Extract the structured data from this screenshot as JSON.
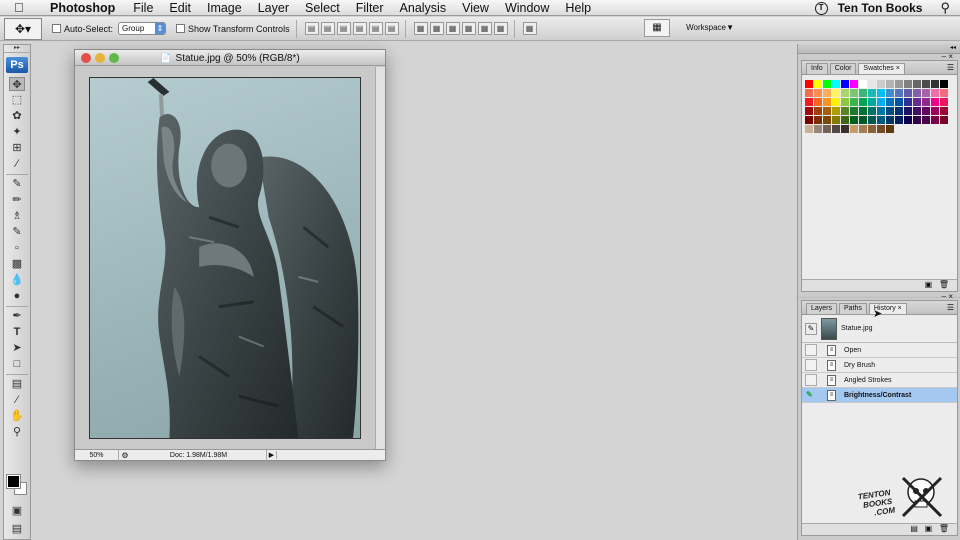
{
  "menubar": {
    "app": "Photoshop",
    "items": [
      "File",
      "Edit",
      "Image",
      "Layer",
      "Select",
      "Filter",
      "Analysis",
      "View",
      "Window",
      "Help"
    ],
    "brand": "Ten Ton Books"
  },
  "options": {
    "auto_select_label": "Auto-Select:",
    "auto_select_value": "Group",
    "transform_label": "Show Transform Controls",
    "workspace_label": "Workspace"
  },
  "toolbox": {
    "logo": "Ps"
  },
  "document": {
    "title": "Statue.jpg @ 50% (RGB/8*)",
    "zoom": "50%",
    "doc_info": "Doc: 1.98M/1.98M"
  },
  "swatches_panel": {
    "tabs": [
      "Info",
      "Color",
      "Swatches"
    ],
    "active_tab": "Swatches",
    "colors": [
      "#ff0000",
      "#ffff00",
      "#00ff00",
      "#00ffff",
      "#0000ff",
      "#ff00ff",
      "#ffffff",
      "#e6e6e6",
      "#cccccc",
      "#b3b3b3",
      "#999999",
      "#808080",
      "#666666",
      "#4d4d4d",
      "#333333",
      "#000000",
      "#f26c4f",
      "#f68e55",
      "#fbaf5c",
      "#fff467",
      "#acd372",
      "#7cc576",
      "#3bb878",
      "#1abbb4",
      "#00bff3",
      "#438ccb",
      "#5574b9",
      "#605ca8",
      "#855fa8",
      "#a763a9",
      "#ef6ea8",
      "#f16d7e",
      "#ed1c24",
      "#f26522",
      "#f7941d",
      "#fff200",
      "#8dc63f",
      "#39b54a",
      "#00a651",
      "#00a99d",
      "#00aeef",
      "#0072bc",
      "#0054a5",
      "#2e3192",
      "#662d91",
      "#92278f",
      "#ec008c",
      "#ed145b",
      "#9e0b0f",
      "#a0410d",
      "#a3620a",
      "#aba000",
      "#598527",
      "#1a7b30",
      "#007236",
      "#00746b",
      "#0076a3",
      "#004b80",
      "#003471",
      "#1b1464",
      "#440e62",
      "#630460",
      "#9e005d",
      "#9e0039",
      "#790000",
      "#7b2e00",
      "#7d4900",
      "#827b00",
      "#406618",
      "#005e20",
      "#005826",
      "#005952",
      "#005b7f",
      "#003663",
      "#002157",
      "#0d004c",
      "#32004b",
      "#4b0049",
      "#7b0046",
      "#7a0026",
      "#c7b299",
      "#998675",
      "#736357",
      "#534741",
      "#37302d",
      "#c69c6d",
      "#a67c52",
      "#8c6239",
      "#754c24",
      "#603913"
    ]
  },
  "history_panel": {
    "tabs": [
      "Layers",
      "Paths",
      "History"
    ],
    "active_tab": "History",
    "snapshot": "Statue.jpg",
    "states": [
      "Open",
      "Dry Brush",
      "Angled Strokes",
      "Brightness/Contrast"
    ],
    "active_state": "Brightness/Contrast"
  },
  "watermark": {
    "line1": "TENTON",
    "line2": "BOOKS",
    "line3": ".COM"
  }
}
